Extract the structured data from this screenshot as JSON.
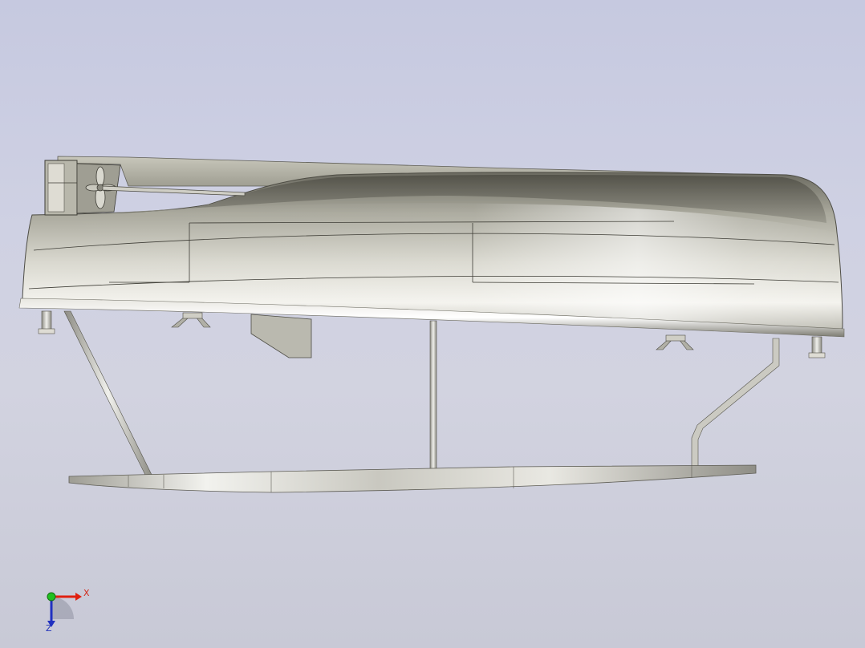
{
  "viewport": {
    "background_top": "#c6c9e0",
    "background_bottom": "#c8c9d6"
  },
  "model": {
    "hull_color": "#c9c8bc",
    "strut_color": "#d8d8d4",
    "foil_color": "#e2e2dc"
  },
  "triad": {
    "x_label": "X",
    "z_label": "Z",
    "x_color": "#e02010",
    "y_color": "#20c020",
    "z_color": "#2030c0"
  }
}
